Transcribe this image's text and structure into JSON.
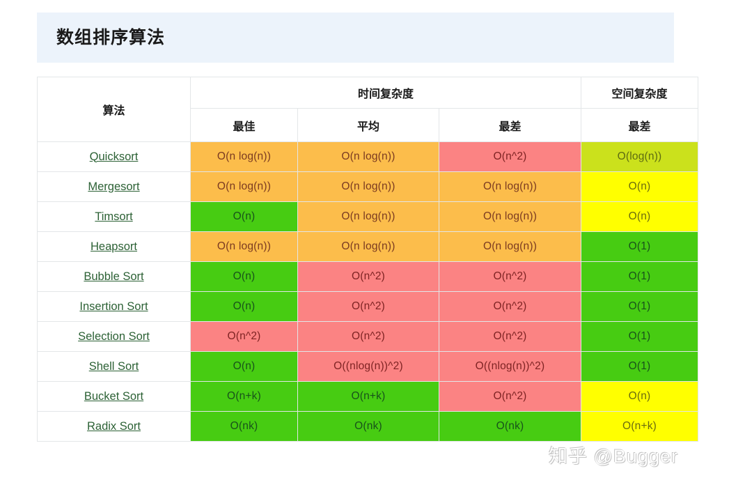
{
  "page": {
    "title": "数组排序算法",
    "watermark": "知乎 @Bugger"
  },
  "table": {
    "headers": {
      "algorithm": "算法",
      "time_complexity": "时间复杂度",
      "space_complexity": "空间复杂度",
      "best": "最佳",
      "average": "平均",
      "worst": "最差",
      "space_worst": "最差"
    },
    "colors": {
      "orange": "#fcbd4b",
      "red": "#fb8383",
      "green": "#47cc12",
      "yellowgreen": "#cbe11c",
      "yellow": "#ffff00",
      "link": "#2c6135",
      "title_band": "#ecf3fb"
    },
    "rows": [
      {
        "algorithm": "Quicksort",
        "best": {
          "value": "O(n log(n))",
          "color": "orange"
        },
        "avg": {
          "value": "O(n log(n))",
          "color": "orange"
        },
        "worst": {
          "value": "O(n^2)",
          "color": "red"
        },
        "space": {
          "value": "O(log(n))",
          "color": "yellowgreen"
        }
      },
      {
        "algorithm": "Mergesort",
        "best": {
          "value": "O(n log(n))",
          "color": "orange"
        },
        "avg": {
          "value": "O(n log(n))",
          "color": "orange"
        },
        "worst": {
          "value": "O(n log(n))",
          "color": "orange"
        },
        "space": {
          "value": "O(n)",
          "color": "yellow"
        }
      },
      {
        "algorithm": "Timsort",
        "best": {
          "value": "O(n)",
          "color": "green"
        },
        "avg": {
          "value": "O(n log(n))",
          "color": "orange"
        },
        "worst": {
          "value": "O(n log(n))",
          "color": "orange"
        },
        "space": {
          "value": "O(n)",
          "color": "yellow"
        }
      },
      {
        "algorithm": "Heapsort",
        "best": {
          "value": "O(n log(n))",
          "color": "orange"
        },
        "avg": {
          "value": "O(n log(n))",
          "color": "orange"
        },
        "worst": {
          "value": "O(n log(n))",
          "color": "orange"
        },
        "space": {
          "value": "O(1)",
          "color": "green"
        }
      },
      {
        "algorithm": "Bubble Sort",
        "best": {
          "value": "O(n)",
          "color": "green"
        },
        "avg": {
          "value": "O(n^2)",
          "color": "red"
        },
        "worst": {
          "value": "O(n^2)",
          "color": "red"
        },
        "space": {
          "value": "O(1)",
          "color": "green"
        }
      },
      {
        "algorithm": "Insertion Sort",
        "best": {
          "value": "O(n)",
          "color": "green"
        },
        "avg": {
          "value": "O(n^2)",
          "color": "red"
        },
        "worst": {
          "value": "O(n^2)",
          "color": "red"
        },
        "space": {
          "value": "O(1)",
          "color": "green"
        }
      },
      {
        "algorithm": "Selection Sort",
        "best": {
          "value": "O(n^2)",
          "color": "red"
        },
        "avg": {
          "value": "O(n^2)",
          "color": "red"
        },
        "worst": {
          "value": "O(n^2)",
          "color": "red"
        },
        "space": {
          "value": "O(1)",
          "color": "green"
        }
      },
      {
        "algorithm": "Shell Sort",
        "best": {
          "value": "O(n)",
          "color": "green"
        },
        "avg": {
          "value": "O((nlog(n))^2)",
          "color": "red"
        },
        "worst": {
          "value": "O((nlog(n))^2)",
          "color": "red"
        },
        "space": {
          "value": "O(1)",
          "color": "green"
        }
      },
      {
        "algorithm": "Bucket Sort",
        "best": {
          "value": "O(n+k)",
          "color": "green"
        },
        "avg": {
          "value": "O(n+k)",
          "color": "green"
        },
        "worst": {
          "value": "O(n^2)",
          "color": "red"
        },
        "space": {
          "value": "O(n)",
          "color": "yellow"
        }
      },
      {
        "algorithm": "Radix Sort",
        "best": {
          "value": "O(nk)",
          "color": "green"
        },
        "avg": {
          "value": "O(nk)",
          "color": "green"
        },
        "worst": {
          "value": "O(nk)",
          "color": "green"
        },
        "space": {
          "value": "O(n+k)",
          "color": "yellow"
        }
      }
    ]
  }
}
